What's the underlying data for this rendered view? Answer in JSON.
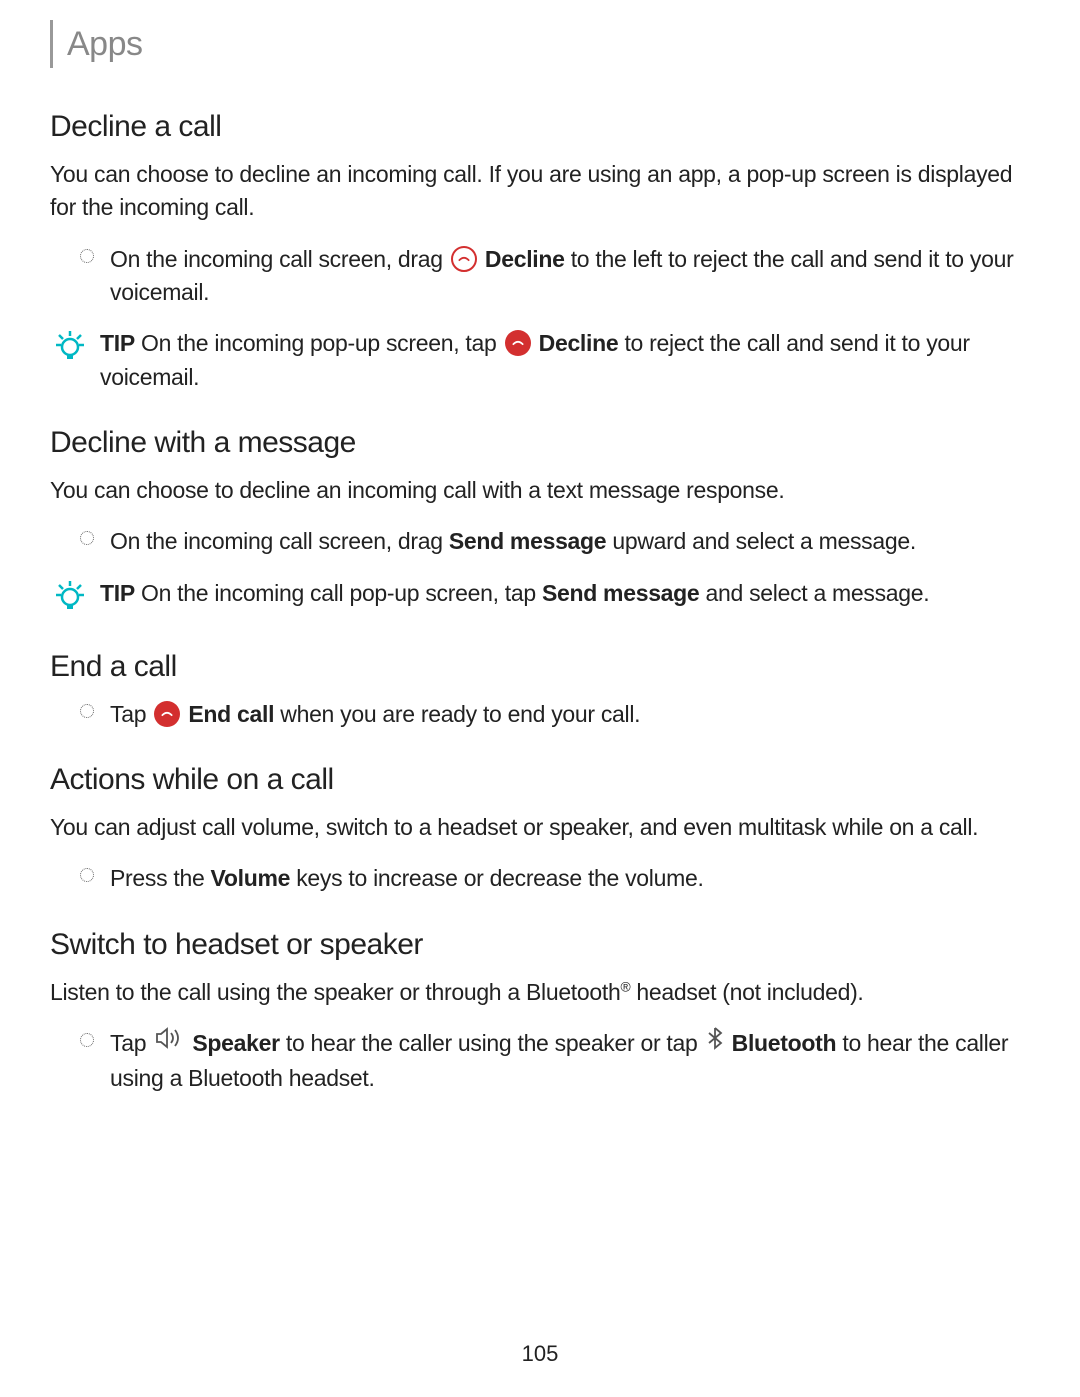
{
  "header": {
    "title": "Apps"
  },
  "sections": {
    "decline": {
      "heading": "Decline a call",
      "intro": "You can choose to decline an incoming call. If you are using an app, a pop-up screen is displayed for the incoming call.",
      "bullet_pre": "On the incoming call screen, drag ",
      "bullet_decline": "Decline",
      "bullet_post": " to the left to reject the call and send it to your voicemail.",
      "tip_label": "TIP",
      "tip_pre": "  On the incoming pop-up screen, tap ",
      "tip_decline": "Decline",
      "tip_post": " to reject the call and send it to your voicemail."
    },
    "decline_msg": {
      "heading": "Decline with a message",
      "intro": "You can choose to decline an incoming call with a text message response.",
      "bullet_pre": "On the incoming call screen, drag ",
      "bullet_bold": "Send message",
      "bullet_post": " upward and select a message.",
      "tip_label": "TIP",
      "tip_pre": "  On the incoming call pop-up screen, tap ",
      "tip_bold": "Send message",
      "tip_post": " and select a message."
    },
    "end_call": {
      "heading": "End a call",
      "bullet_pre": "Tap ",
      "bullet_bold": "End call",
      "bullet_post": " when you are ready to end your call."
    },
    "actions": {
      "heading": "Actions while on a call",
      "intro": "You can adjust call volume, switch to a headset or speaker, and even multitask while on a call.",
      "bullet_pre": "Press the ",
      "bullet_bold": "Volume",
      "bullet_post": " keys to increase or decrease the volume."
    },
    "switch": {
      "heading": "Switch to headset or speaker",
      "intro_pre": "Listen to the call using the speaker or through a Bluetooth",
      "intro_sup": "®",
      "intro_post": " headset (not included).",
      "bullet_pre": "Tap ",
      "bullet_speaker": "Speaker",
      "bullet_mid": " to hear the caller using the speaker or tap ",
      "bullet_bluetooth": "Bluetooth",
      "bullet_post": " to hear the caller using a Bluetooth headset."
    }
  },
  "page_number": "105",
  "colors": {
    "accent_red": "#d32f2f",
    "tip_teal": "#00b8c4"
  }
}
